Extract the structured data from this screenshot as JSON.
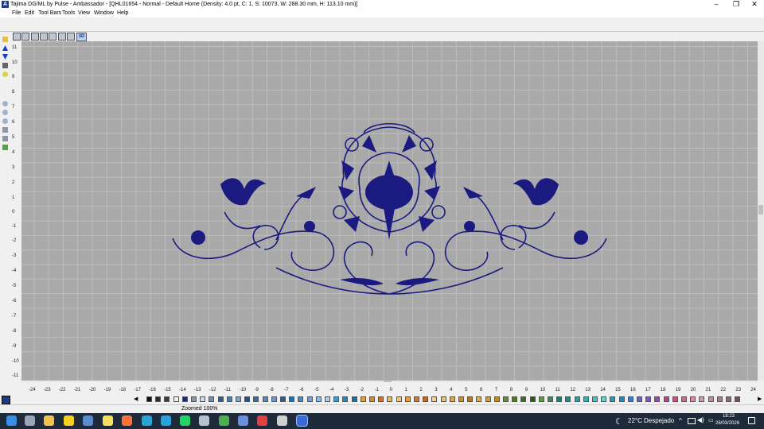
{
  "window": {
    "title": "Tajima DG/ML by Pulse - Ambassador - [QHL01654 - Normal - Default Home (Density: 4.0 pt, C: 1, S: 10073, W: 288.30 mm, H: 113.10 mm)]",
    "app_icon_letter": "A",
    "controls": {
      "minimize": "–",
      "maximize": "❐",
      "close": "✕"
    }
  },
  "menu": {
    "items": [
      "File",
      "Edit",
      "Tool Bars",
      "Tools",
      "View",
      "Window",
      "Help"
    ]
  },
  "toolbar": {
    "view_3d_label": "3D"
  },
  "rulers": {
    "vertical_labels": [
      "11",
      "10",
      "9",
      "8",
      "7",
      "6",
      "5",
      "4",
      "3",
      "2",
      "1",
      "0",
      "-1",
      "-2",
      "-3",
      "-4",
      "-5",
      "-6",
      "-7",
      "-8",
      "-9",
      "-10",
      "-11"
    ],
    "horizontal_labels": [
      "-24",
      "-23",
      "-22",
      "-21",
      "-20",
      "-19",
      "-18",
      "-17",
      "-16",
      "-15",
      "-14",
      "-13",
      "-12",
      "-11",
      "-10",
      "-9",
      "-8",
      "-7",
      "-6",
      "-5",
      "-4",
      "-3",
      "-2",
      "-1",
      "0",
      "1",
      "2",
      "3",
      "4",
      "5",
      "6",
      "7",
      "8",
      "9",
      "10",
      "11",
      "12",
      "13",
      "14",
      "15",
      "16",
      "17",
      "18",
      "19",
      "20",
      "21",
      "22",
      "23",
      "24"
    ]
  },
  "design": {
    "thread_color": "#1a1a80"
  },
  "palette": {
    "colors": [
      "#111111",
      "#2a2a2a",
      "#3c3c3c",
      "#f0f0f0",
      "#1a2a6a",
      "#8a94a8",
      "#d0d8e4",
      "#6a8fb4",
      "#2f5e8c",
      "#4c7ca8",
      "#7da7cc",
      "#2b4c7e",
      "#3f6da0",
      "#5a86b8",
      "#7299c4",
      "#2c5a90",
      "#1f6fb2",
      "#4a8cc8",
      "#6fa3d6",
      "#8fbce0",
      "#b0d0ea",
      "#3aa0d0",
      "#2b86b8",
      "#1c6e9e",
      "#e0a040",
      "#d88a2a",
      "#c8742a",
      "#e8b860",
      "#f0c878",
      "#e89c4c",
      "#d07a30",
      "#c06a20",
      "#f0d090",
      "#e8c070",
      "#d8a850",
      "#c89030",
      "#b07828",
      "#e0b040",
      "#d0a030",
      "#c09020",
      "#6a8c3a",
      "#4a7a2a",
      "#3a6a24",
      "#2a5a20",
      "#5a9a4a",
      "#3c8a5a",
      "#2a7a6a",
      "#1a8a8a",
      "#2aa0a0",
      "#3ab0b0",
      "#4ac0c0",
      "#6ad0d0",
      "#2a9ab0",
      "#1a8ac0",
      "#3a7ad0",
      "#5a6ac0",
      "#7a5ab0",
      "#9a4aa0",
      "#b04a8a",
      "#c05a7a",
      "#d06a8a",
      "#e08aa0",
      "#c8a0b0",
      "#b890a0",
      "#a08090",
      "#886878",
      "#705060"
    ],
    "scroll_left": "◀",
    "scroll_right": "▶"
  },
  "status": {
    "zoom_text": "Zoomed 100%"
  },
  "taskbar": {
    "apps": [
      {
        "name": "start",
        "color": "#3a8ee6"
      },
      {
        "name": "task-view",
        "color": "#9aa6b8"
      },
      {
        "name": "file-explorer",
        "color": "#f2c14e"
      },
      {
        "name": "norton",
        "color": "#f5d020"
      },
      {
        "name": "window-app",
        "color": "#5a8ad0"
      },
      {
        "name": "sticky-notes",
        "color": "#f6e05e"
      },
      {
        "name": "firefox",
        "color": "#ff7139"
      },
      {
        "name": "edge",
        "color": "#2aa4d4"
      },
      {
        "name": "telegram",
        "color": "#2aa2dc"
      },
      {
        "name": "whatsapp",
        "color": "#25d366"
      },
      {
        "name": "app-gray",
        "color": "#b8c0cc"
      },
      {
        "name": "chrome",
        "color": "#4caf50"
      },
      {
        "name": "app-blue",
        "color": "#6a8ee0"
      },
      {
        "name": "app-red",
        "color": "#e04040"
      },
      {
        "name": "app-stitch",
        "color": "#d0d0d0"
      },
      {
        "name": "tajima-active",
        "color": "#3a6ad8"
      }
    ],
    "weather_temp": "22°C",
    "weather_text": "Despejado",
    "time": "18:23",
    "date": "26/03/2026"
  }
}
